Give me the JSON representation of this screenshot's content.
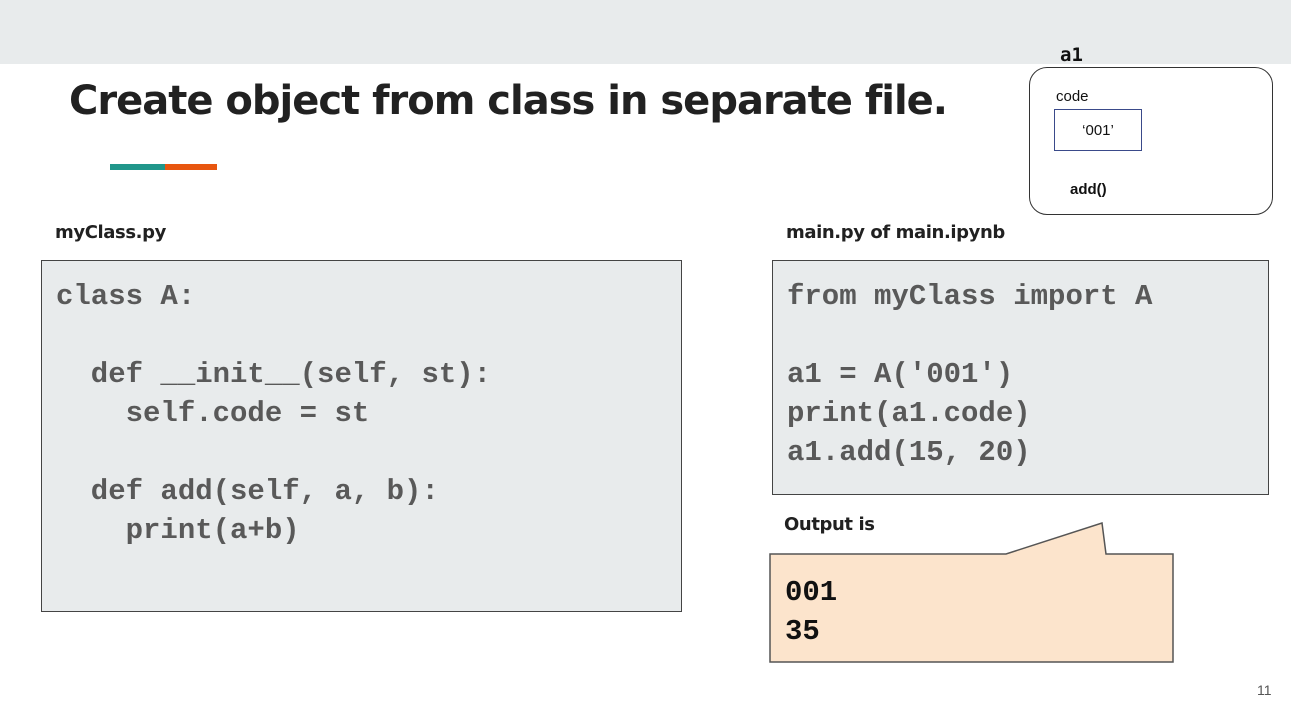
{
  "slide": {
    "title": "Create object from class in separate file.",
    "page_number": "11"
  },
  "object_diagram": {
    "name": "a1",
    "attribute_label": "code",
    "attribute_value": "‘001’",
    "method": "add()"
  },
  "left_file": {
    "label": "myClass.py",
    "code": "class A:\n\n  def __init__(self, st):\n    self.code = st\n\n  def add(self, a, b):\n    print(a+b)"
  },
  "right_file": {
    "label": "main.py of main.ipynb",
    "import_line": "from myClass import A",
    "code": "a1 = A('001')\nprint(a1.code)\na1.add(15, 20)"
  },
  "output": {
    "label": "Output is",
    "text": "001\n35"
  },
  "colors": {
    "accent_teal": "#20968a",
    "accent_orange": "#e8560f",
    "code_panel_bg": "#e8ebec",
    "output_bg": "#fce4cc",
    "import_keyword": "#e6590f"
  }
}
